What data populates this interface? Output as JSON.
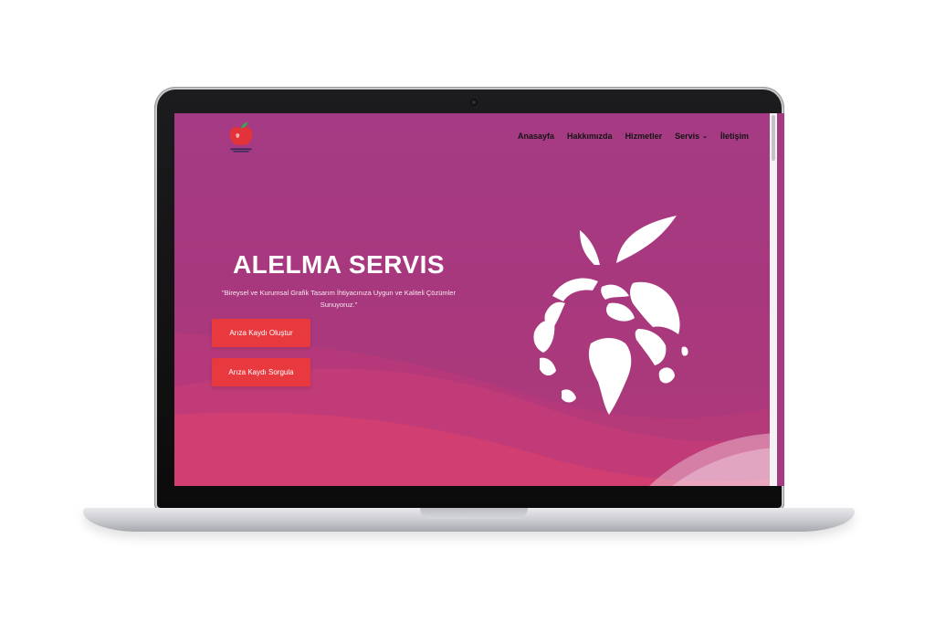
{
  "nav": {
    "items": [
      {
        "label": "Anasayfa"
      },
      {
        "label": "Hakkımızda"
      },
      {
        "label": "Hizmetler"
      },
      {
        "label": "Servis"
      },
      {
        "label": "İletişim"
      }
    ],
    "dropdown_icon": "chevron-down-icon"
  },
  "hero": {
    "title": "ALELMA SERVIS",
    "subtitle": "\"Bireysel ve Kurumsal Grafik Tasarım İhtiyacınıza Uygun ve Kaliteli Çözümler Sunuyoruz.\""
  },
  "buttons": {
    "create": "Arıza Kaydı Oluştur",
    "query": "Arıza Kaydı Sorgula"
  },
  "colors": {
    "background": "#a53a80",
    "button": "#e8393f",
    "nav_text": "#141414",
    "hero_text": "#ffffff"
  },
  "illustration": "apple-globe-icon",
  "logo": "apple-logo-icon"
}
